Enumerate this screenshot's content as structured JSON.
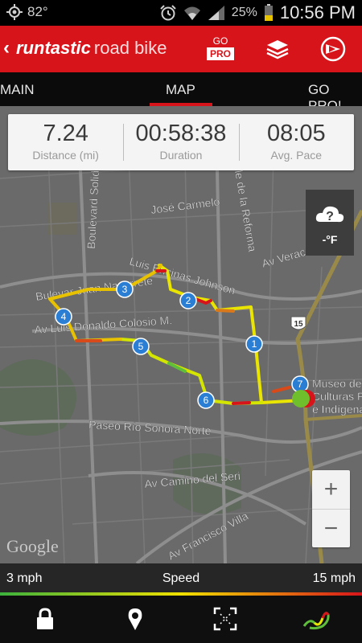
{
  "status_bar": {
    "temperature": "82°",
    "battery": "25%",
    "time": "10:56 PM"
  },
  "app_bar": {
    "brand_main": "runtastic",
    "brand_sub": "road bike",
    "go_label": "GO",
    "pro_label": "PRO",
    "icons": [
      "back-chevron-icon",
      "layers-icon",
      "story-run-icon"
    ]
  },
  "tabs": {
    "items": [
      "MAIN",
      "MAP",
      "GO PRO!"
    ],
    "active": "MAP"
  },
  "stats": [
    {
      "value": "7.24",
      "label": "Distance (mi)"
    },
    {
      "value": "00:58:38",
      "label": "Duration"
    },
    {
      "value": "08:05",
      "label": "Avg. Pace"
    }
  ],
  "weather": {
    "temp": "-°F",
    "icon": "weather-unknown-icon"
  },
  "map": {
    "streets": [
      "José Carmelo",
      "Boulevard Solidaridad",
      "Calle de la Reforma",
      "Luis Encinas Johnson",
      "Av Veracruz",
      "Bulevar Juan Navarrete",
      "Av Luis Donaldo Colosio M.",
      "Paseo Río Sonora Norte",
      "Av Camino del Seri",
      "Av Francisco Villa"
    ],
    "poi": [
      "Museo de",
      "Culturas P",
      "e Indígena"
    ],
    "highway_shield": "15",
    "markers": [
      "1",
      "2",
      "3",
      "4",
      "5",
      "6",
      "7"
    ],
    "attribution": "Google",
    "zoom_in": "+",
    "zoom_out": "−"
  },
  "speed_legend": {
    "min": "3 mph",
    "title": "Speed",
    "max": "15 mph",
    "colors": [
      "#3cb23c",
      "#f0e000",
      "#d8141b"
    ]
  },
  "bottom_bar": {
    "icons": [
      "lock-icon",
      "location-pin-icon",
      "fullscreen-icon",
      "speed-route-icon"
    ]
  }
}
